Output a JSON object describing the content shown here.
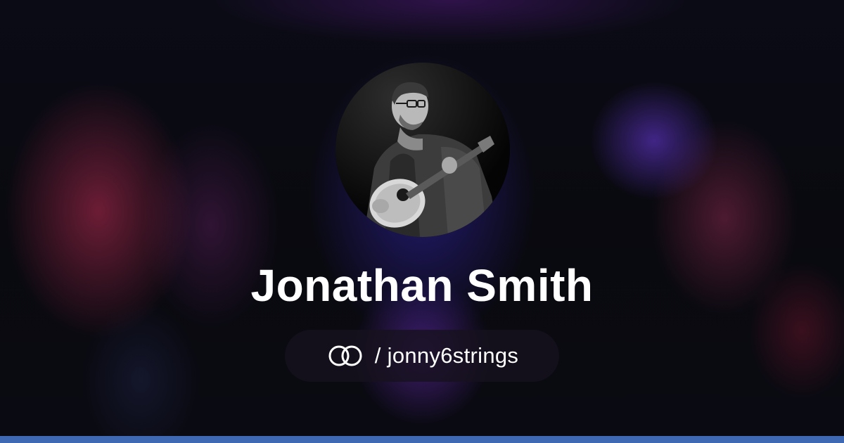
{
  "profile": {
    "name": "Jonathan Smith",
    "separator": "/",
    "username": "jonny6strings",
    "avatar": "profile-photo: man with glasses playing acoustic guitar (black & white)"
  },
  "icons": {
    "brand_logo": "interlocking-rings-icon"
  },
  "colors": {
    "background": "#09090f",
    "text": "#ffffff",
    "pill_background": "#16121e",
    "bottom_bar": "#3f6ab3"
  }
}
